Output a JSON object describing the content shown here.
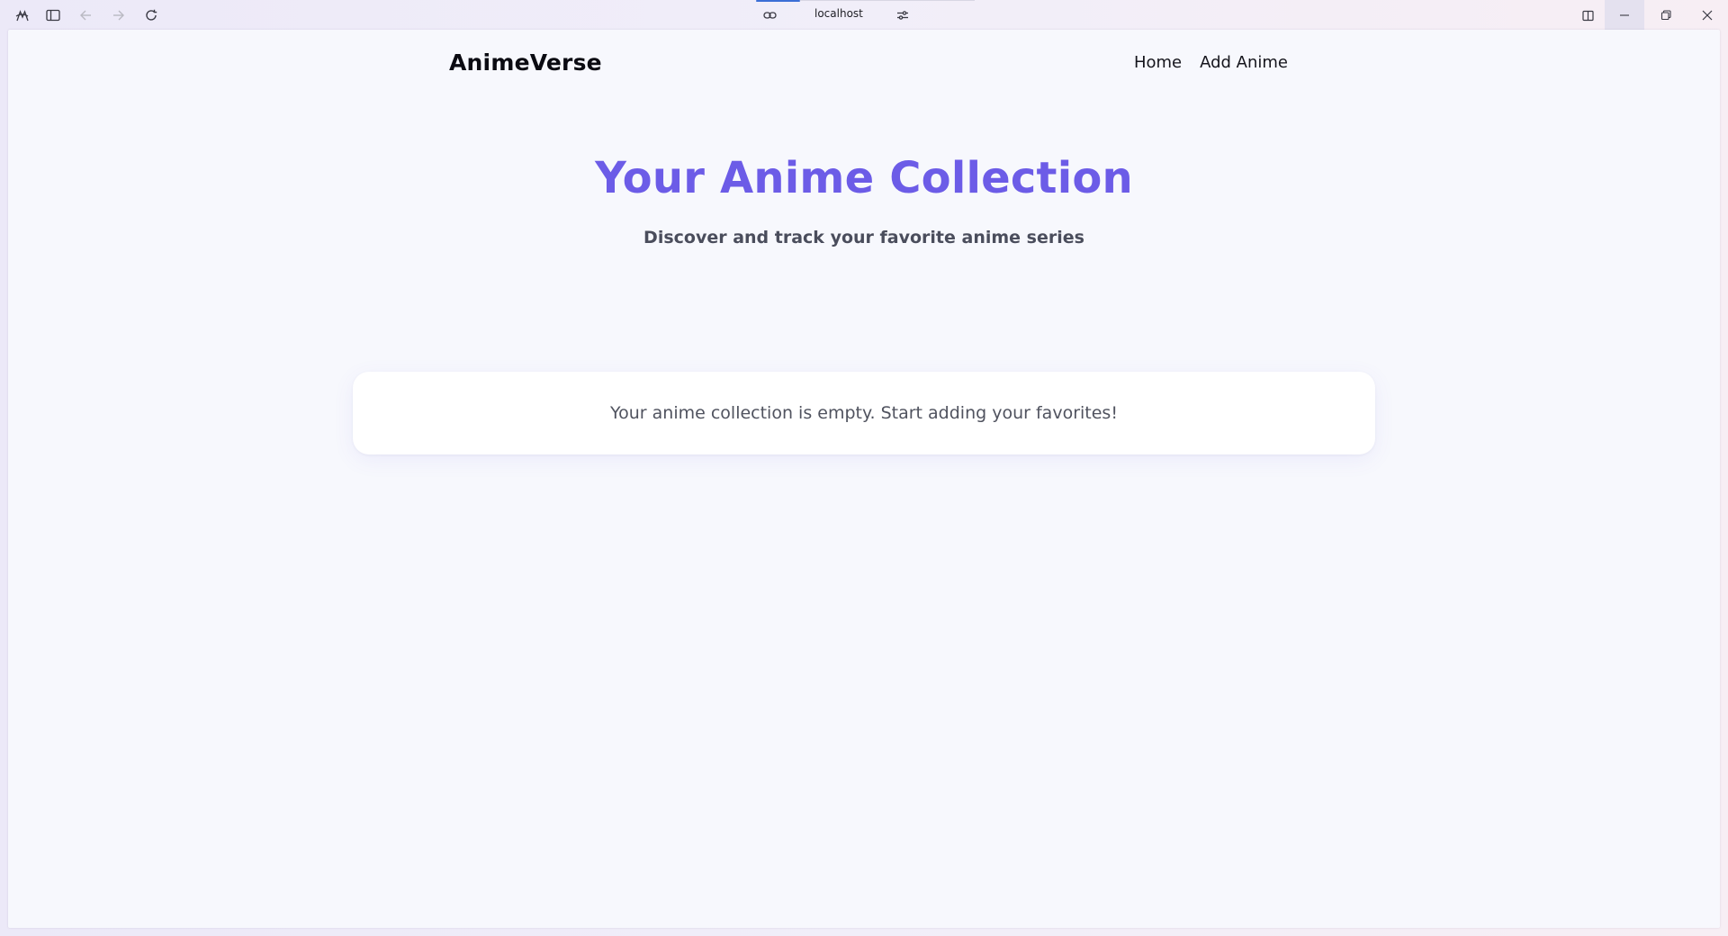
{
  "browser": {
    "url": "localhost",
    "icons": {
      "app": "copilot-icon",
      "sidebar": "sidebar-toggle-icon",
      "back": "arrow-left-icon",
      "forward": "arrow-right-icon",
      "reload": "reload-icon",
      "link": "link-icon",
      "settings": "sliders-icon",
      "split": "split-view-icon",
      "minimize": "minimize-icon",
      "restore": "restore-icon",
      "close": "close-icon"
    }
  },
  "page": {
    "brand": "AnimeVerse",
    "nav": [
      {
        "label": "Home"
      },
      {
        "label": "Add Anime"
      }
    ],
    "hero": {
      "title": "Your Anime Collection",
      "subtitle": "Discover and track your favorite anime series"
    },
    "empty_message": "Your anime collection is empty. Start adding your favorites!"
  },
  "colors": {
    "accent": "#6c5ce7",
    "page_bg": "#f7f8fd",
    "card_bg": "#ffffff"
  }
}
